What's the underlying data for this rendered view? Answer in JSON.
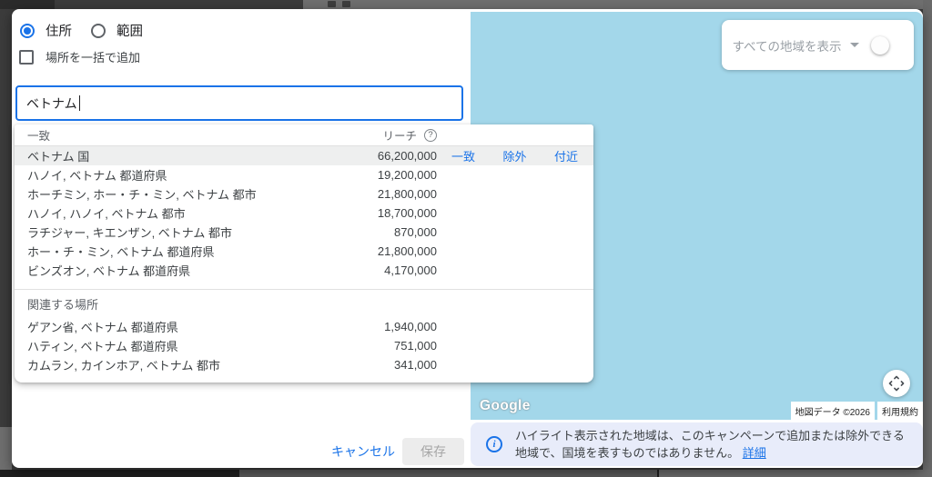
{
  "form": {
    "type_options": [
      {
        "label": "住所",
        "selected": true
      },
      {
        "label": "範囲",
        "selected": false
      }
    ],
    "bulk_add_label": "場所を一括で追加",
    "search_value": "ベトナム"
  },
  "dropdown": {
    "match_header": "一致",
    "reach_header": "リーチ",
    "help_glyph": "?",
    "actions": [
      "一致",
      "除外",
      "付近"
    ],
    "matches": [
      {
        "name": "ベトナム 国",
        "reach": "66,200,000",
        "selected": true
      },
      {
        "name": "ハノイ, ベトナム 都道府県",
        "reach": "19,200,000",
        "selected": false
      },
      {
        "name": "ホーチミン, ホー・チ・ミン, ベトナム 都市",
        "reach": "21,800,000",
        "selected": false
      },
      {
        "name": "ハノイ, ハノイ, ベトナム 都市",
        "reach": "18,700,000",
        "selected": false
      },
      {
        "name": "ラチジャー, キエンザン, ベトナム 都市",
        "reach": "870,000",
        "selected": false
      },
      {
        "name": "ホー・チ・ミン, ベトナム 都道府県",
        "reach": "21,800,000",
        "selected": false
      },
      {
        "name": "ビンズオン, ベトナム 都道府県",
        "reach": "4,170,000",
        "selected": false
      }
    ],
    "related_header": "関連する場所",
    "related": [
      {
        "name": "ゲアン省, ベトナム 都道府県",
        "reach": "1,940,000"
      },
      {
        "name": "ハティン, ベトナム 都道府県",
        "reach": "751,000"
      },
      {
        "name": "カムラン, カインホア, ベトナム 都市",
        "reach": "341,000"
      }
    ]
  },
  "map": {
    "regions_toggle_label": "すべての地域を表示",
    "toggle_on": false,
    "logo": "Google",
    "attribution": "地図データ ©2026",
    "terms": "利用規約"
  },
  "notice": {
    "text": "ハイライト表示された地域は、このキャンペーンで追加または除外できる地域で、国境を表すものではありません。",
    "link": "詳細"
  },
  "footer": {
    "cancel": "キャンセル",
    "save": "保存"
  },
  "colors": {
    "accent_blue": "#1A73E8",
    "map_water": "#A3D7EA",
    "notice_bg": "#E8ECFA",
    "row_highlight": "#EEEFEF"
  }
}
